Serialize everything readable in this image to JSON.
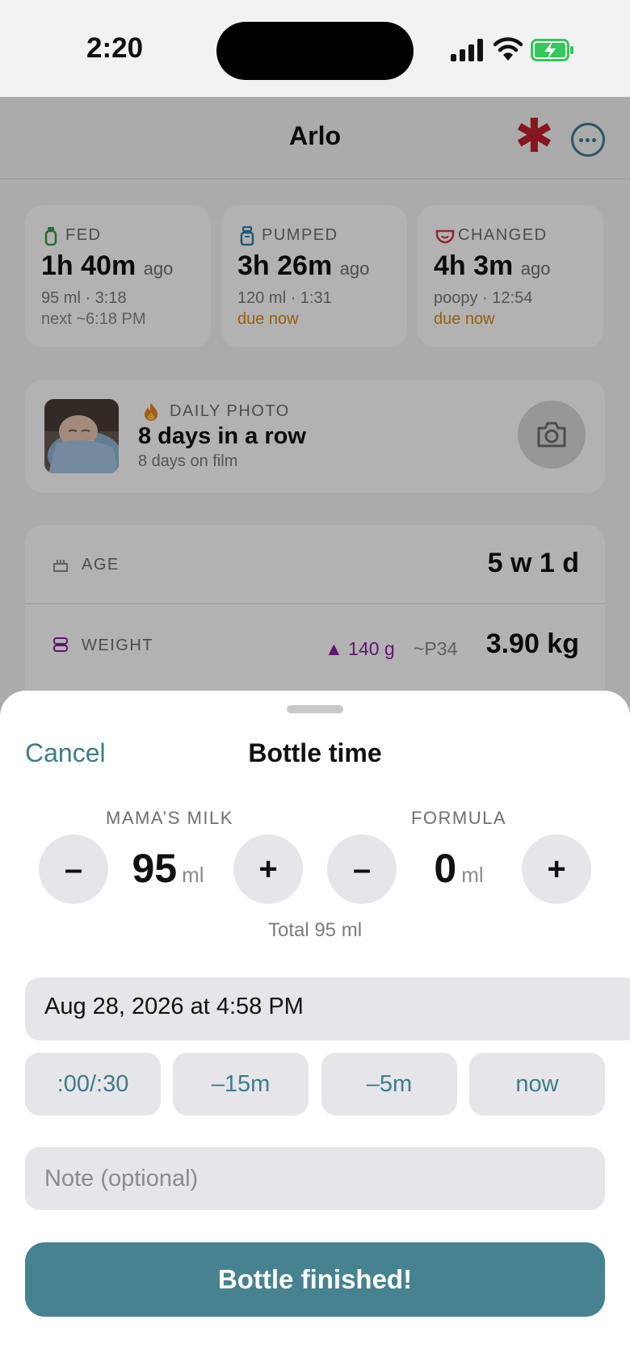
{
  "status_bar": {
    "time": "2:20"
  },
  "header": {
    "title": "Arlo"
  },
  "stats": [
    {
      "label": "FED",
      "value": "1h 40m",
      "suffix": "ago",
      "line1": "95 ml · 3:18",
      "line2": "next ~6:18 PM"
    },
    {
      "label": "PUMPED",
      "value": "3h 26m",
      "suffix": "ago",
      "line1": "120 ml · 1:31",
      "line2": "due now"
    },
    {
      "label": "CHANGED",
      "value": "4h 3m",
      "suffix": "ago",
      "line1": "poopy · 12:54",
      "line2": "due now"
    }
  ],
  "daily_photo": {
    "label": "DAILY PHOTO",
    "streak": "8 days in a row",
    "sub": "8 days on film"
  },
  "info_rows": {
    "age": {
      "label": "AGE",
      "value": "5 w 1 d"
    },
    "weight": {
      "label": "WEIGHT",
      "delta": "▲ 140 g",
      "percentile": "~P34",
      "value": "3.90 kg"
    }
  },
  "sheet": {
    "cancel_label": "Cancel",
    "title": "Bottle time",
    "mamas_milk": {
      "label": "MAMA’S MILK",
      "value": "95",
      "unit": "ml"
    },
    "formula": {
      "label": "FORMULA",
      "value": "0",
      "unit": "ml"
    },
    "minus_label": "–",
    "plus_label": "+",
    "total": "Total 95 ml",
    "datetime": "Aug 28, 2026 at 4:58 PM",
    "chips": [
      ":00/:30",
      "–15m",
      "–5m",
      "now"
    ],
    "note_placeholder": "Note (optional)",
    "submit_label": "Bottle finished!"
  },
  "colors": {
    "accent": "#46828f",
    "accent_text": "#3c7d8a",
    "due": "#d88a0f",
    "weight_delta": "#8a1fa0",
    "alert": "#c2202c"
  }
}
